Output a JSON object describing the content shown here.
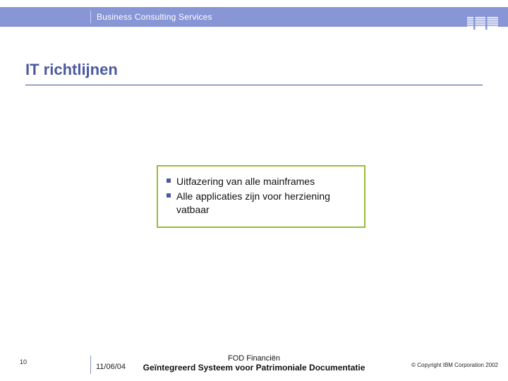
{
  "header": {
    "brand_unit": "Business Consulting Services",
    "logo_label": "IBM"
  },
  "title": "IT richtlijnen",
  "callout": {
    "bullets": [
      "Uitfazering van alle mainframes",
      "Alle applicaties zijn voor herziening vatbaar"
    ]
  },
  "footer": {
    "page_number": "10",
    "date": "11/06/04",
    "center_line1": "FOD Financiën",
    "center_line2": "Geïntegreerd Systeem voor Patrimoniale Documentatie",
    "copyright": "© Copyright IBM Corporation 2002"
  }
}
